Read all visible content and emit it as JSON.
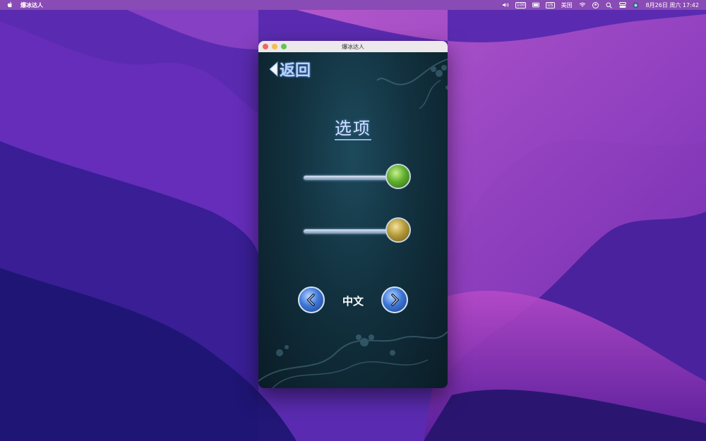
{
  "menubar": {
    "app_name": "爆冰达人",
    "input_badge": "US",
    "input_label": "美国",
    "battery_label": "100",
    "datetime": "8月26日 周六  17:42"
  },
  "window": {
    "title": "爆冰达人"
  },
  "game": {
    "back_label": "返回",
    "title": "选项",
    "sliders": [
      {
        "name": "music",
        "level": 1.0,
        "knob_color": "#5fae2e"
      },
      {
        "name": "sound",
        "level": 1.0,
        "knob_color": "#b59a3a"
      }
    ],
    "language": "中文"
  },
  "colors": {
    "accent": "#b8d4ff",
    "game_bg": "#12313f"
  }
}
